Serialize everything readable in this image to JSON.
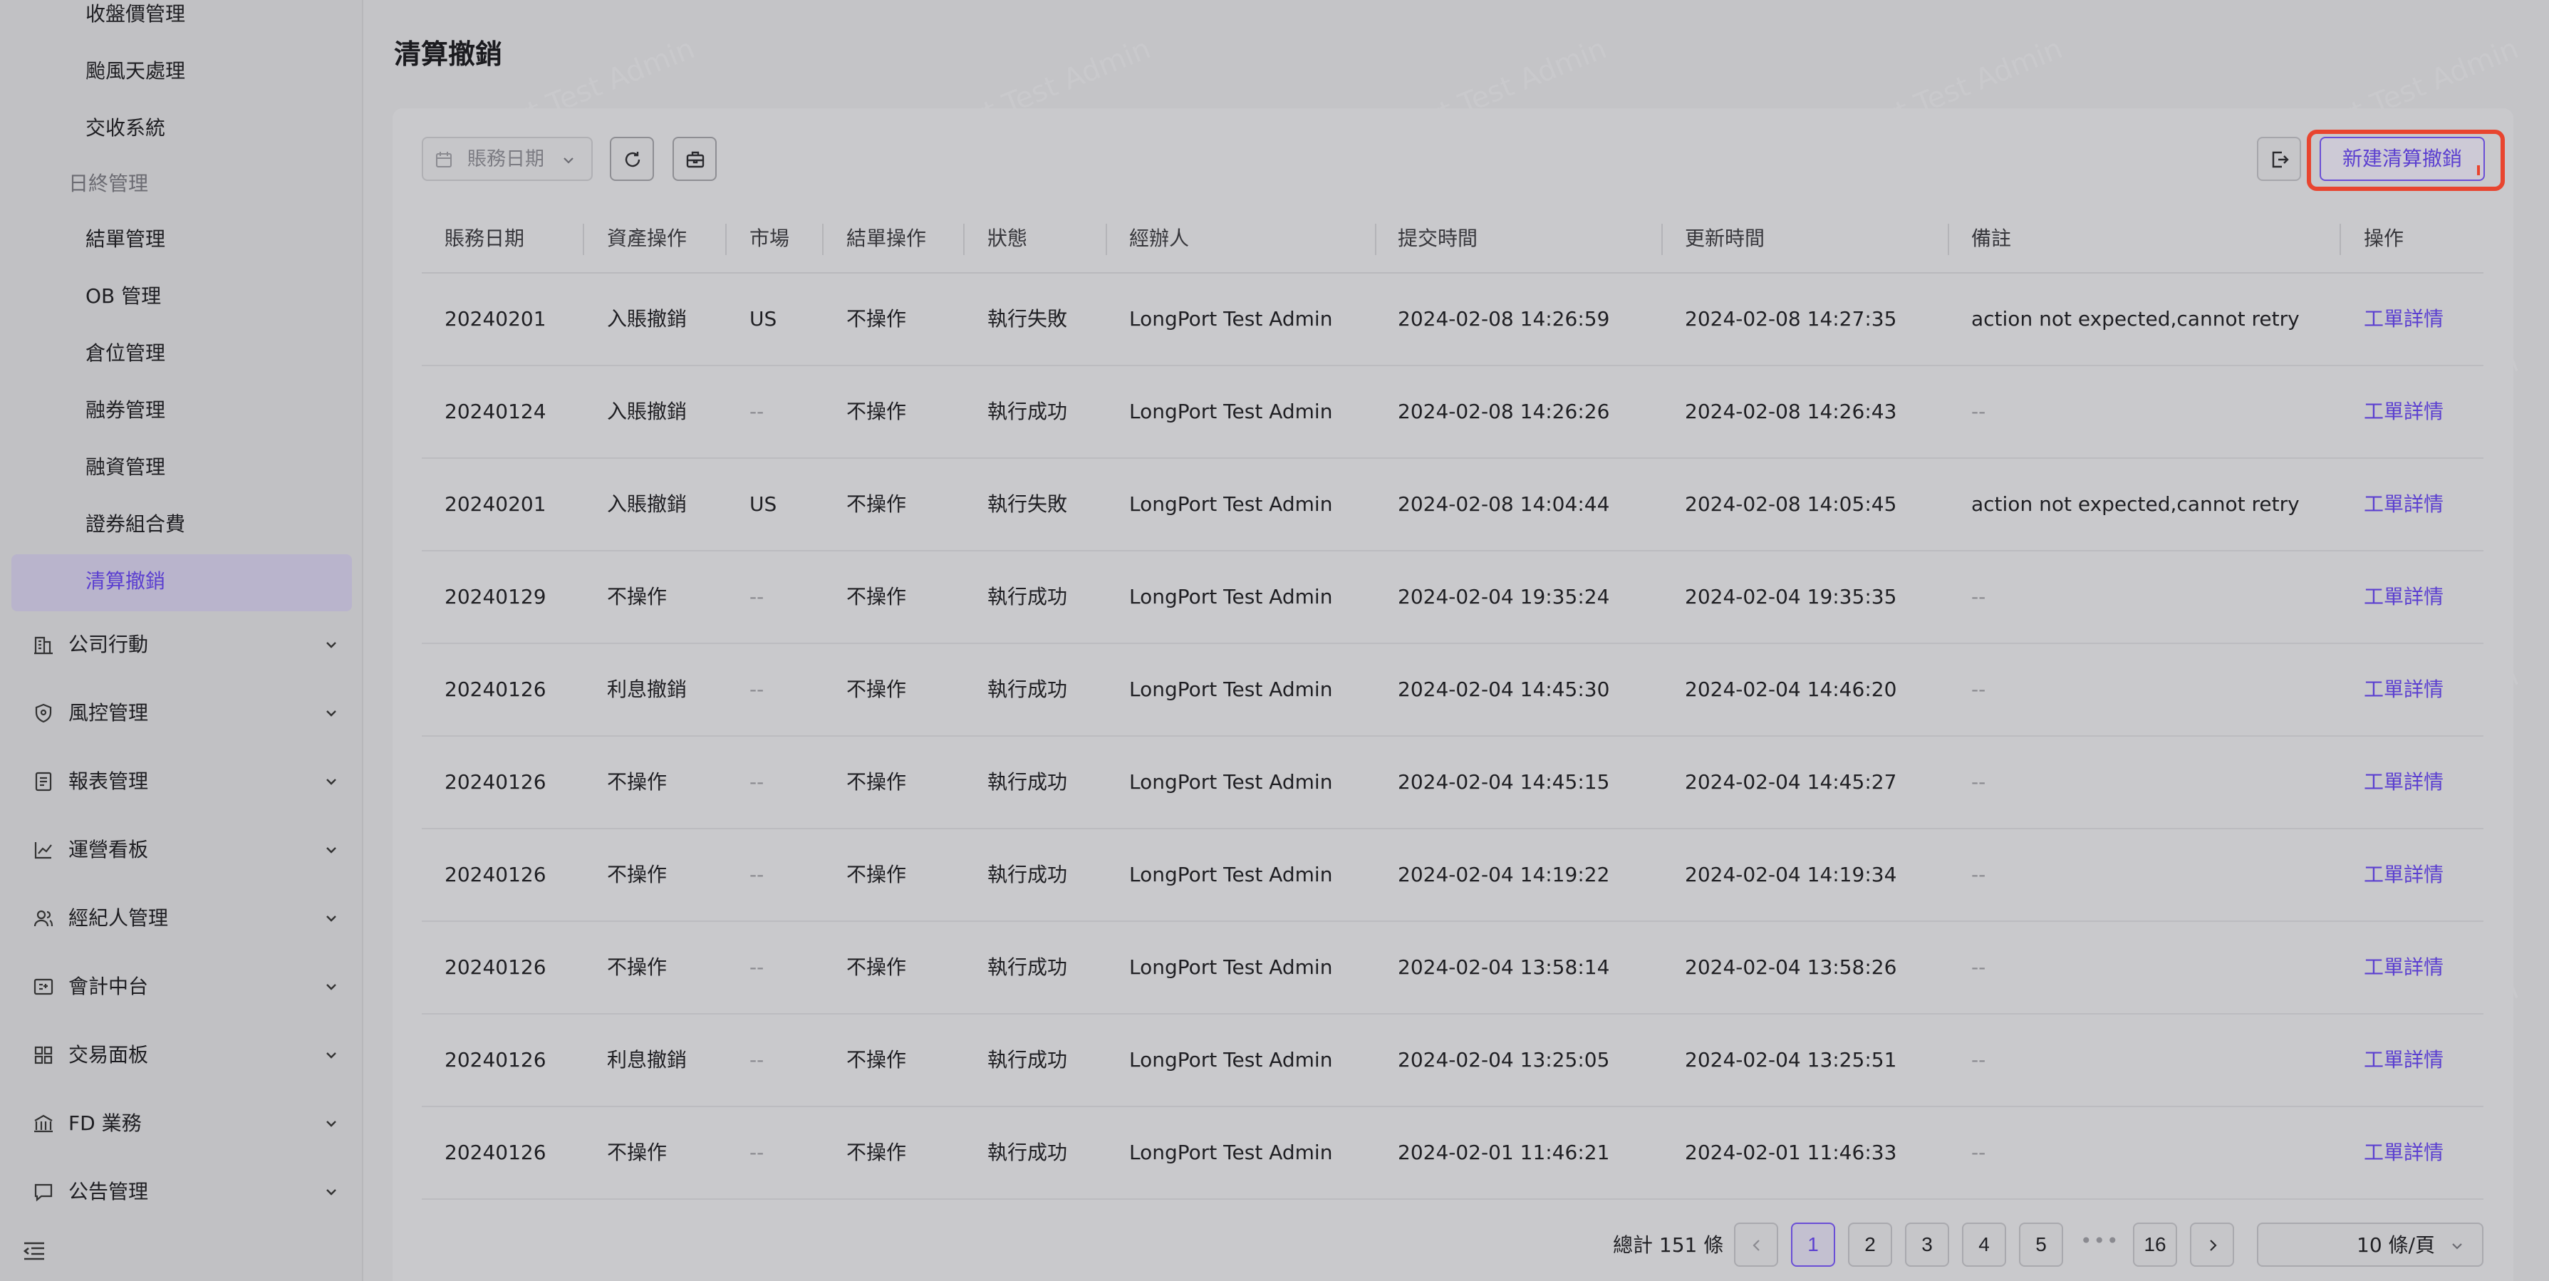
{
  "sidebar": {
    "sub_items": [
      {
        "label": "收盤價管理"
      },
      {
        "label": "颱風天處理"
      },
      {
        "label": "交收系統"
      }
    ],
    "group_label": "日終管理",
    "day_end_items": [
      {
        "label": "結單管理"
      },
      {
        "label": "OB 管理"
      },
      {
        "label": "倉位管理"
      },
      {
        "label": "融券管理"
      },
      {
        "label": "融資管理"
      },
      {
        "label": "證券組合費"
      },
      {
        "label": "清算撤銷"
      }
    ],
    "top_items": [
      {
        "label": "公司行動",
        "icon": "building-icon"
      },
      {
        "label": "風控管理",
        "icon": "shield-icon"
      },
      {
        "label": "報表管理",
        "icon": "report-icon"
      },
      {
        "label": "運營看板",
        "icon": "line-chart-icon"
      },
      {
        "label": "經紀人管理",
        "icon": "users-icon"
      },
      {
        "label": "會計中台",
        "icon": "accounting-icon"
      },
      {
        "label": "交易面板",
        "icon": "grid-icon"
      },
      {
        "label": "FD 業務",
        "icon": "bank-icon"
      },
      {
        "label": "公告管理",
        "icon": "message-icon"
      }
    ]
  },
  "page": {
    "title": "清算撤銷"
  },
  "toolbar": {
    "date_placeholder": "賬務日期",
    "create_label": "新建清算撤銷"
  },
  "table": {
    "columns": [
      "賬務日期",
      "資產操作",
      "市場",
      "結單操作",
      "狀態",
      "經辦人",
      "提交時間",
      "更新時間",
      "備註",
      "操作"
    ],
    "rows": [
      {
        "date": "20240201",
        "asset_op": "入賬撤銷",
        "market": "US",
        "statement_op": "不操作",
        "status": "執行失敗",
        "handler": "LongPort Test Admin",
        "submitted": "2024-02-08 14:26:59",
        "updated": "2024-02-08 14:27:35",
        "remark": "action not expected,cannot retry",
        "action": "工單詳情"
      },
      {
        "date": "20240124",
        "asset_op": "入賬撤銷",
        "market": "--",
        "statement_op": "不操作",
        "status": "執行成功",
        "handler": "LongPort Test Admin",
        "submitted": "2024-02-08 14:26:26",
        "updated": "2024-02-08 14:26:43",
        "remark": "--",
        "action": "工單詳情"
      },
      {
        "date": "20240201",
        "asset_op": "入賬撤銷",
        "market": "US",
        "statement_op": "不操作",
        "status": "執行失敗",
        "handler": "LongPort Test Admin",
        "submitted": "2024-02-08 14:04:44",
        "updated": "2024-02-08 14:05:45",
        "remark": "action not expected,cannot retry",
        "action": "工單詳情"
      },
      {
        "date": "20240129",
        "asset_op": "不操作",
        "market": "--",
        "statement_op": "不操作",
        "status": "執行成功",
        "handler": "LongPort Test Admin",
        "submitted": "2024-02-04 19:35:24",
        "updated": "2024-02-04 19:35:35",
        "remark": "--",
        "action": "工單詳情"
      },
      {
        "date": "20240126",
        "asset_op": "利息撤銷",
        "market": "--",
        "statement_op": "不操作",
        "status": "執行成功",
        "handler": "LongPort Test Admin",
        "submitted": "2024-02-04 14:45:30",
        "updated": "2024-02-04 14:46:20",
        "remark": "--",
        "action": "工單詳情"
      },
      {
        "date": "20240126",
        "asset_op": "不操作",
        "market": "--",
        "statement_op": "不操作",
        "status": "執行成功",
        "handler": "LongPort Test Admin",
        "submitted": "2024-02-04 14:45:15",
        "updated": "2024-02-04 14:45:27",
        "remark": "--",
        "action": "工單詳情"
      },
      {
        "date": "20240126",
        "asset_op": "不操作",
        "market": "--",
        "statement_op": "不操作",
        "status": "執行成功",
        "handler": "LongPort Test Admin",
        "submitted": "2024-02-04 14:19:22",
        "updated": "2024-02-04 14:19:34",
        "remark": "--",
        "action": "工單詳情"
      },
      {
        "date": "20240126",
        "asset_op": "不操作",
        "market": "--",
        "statement_op": "不操作",
        "status": "執行成功",
        "handler": "LongPort Test Admin",
        "submitted": "2024-02-04 13:58:14",
        "updated": "2024-02-04 13:58:26",
        "remark": "--",
        "action": "工單詳情"
      },
      {
        "date": "20240126",
        "asset_op": "利息撤銷",
        "market": "--",
        "statement_op": "不操作",
        "status": "執行成功",
        "handler": "LongPort Test Admin",
        "submitted": "2024-02-04 13:25:05",
        "updated": "2024-02-04 13:25:51",
        "remark": "--",
        "action": "工單詳情"
      },
      {
        "date": "20240126",
        "asset_op": "不操作",
        "market": "--",
        "statement_op": "不操作",
        "status": "執行成功",
        "handler": "LongPort Test Admin",
        "submitted": "2024-02-01 11:46:21",
        "updated": "2024-02-01 11:46:33",
        "remark": "--",
        "action": "工單詳情"
      }
    ]
  },
  "pagination": {
    "total": "總計 151 條",
    "pages": [
      "1",
      "2",
      "3",
      "4",
      "5"
    ],
    "ellipsis": "•••",
    "last_page": "16",
    "current": "1",
    "page_size": "10 條/頁"
  },
  "watermark": "LongPort Test Admin",
  "colors": {
    "accent": "#5b3fd0",
    "highlight": "#e8452f"
  }
}
